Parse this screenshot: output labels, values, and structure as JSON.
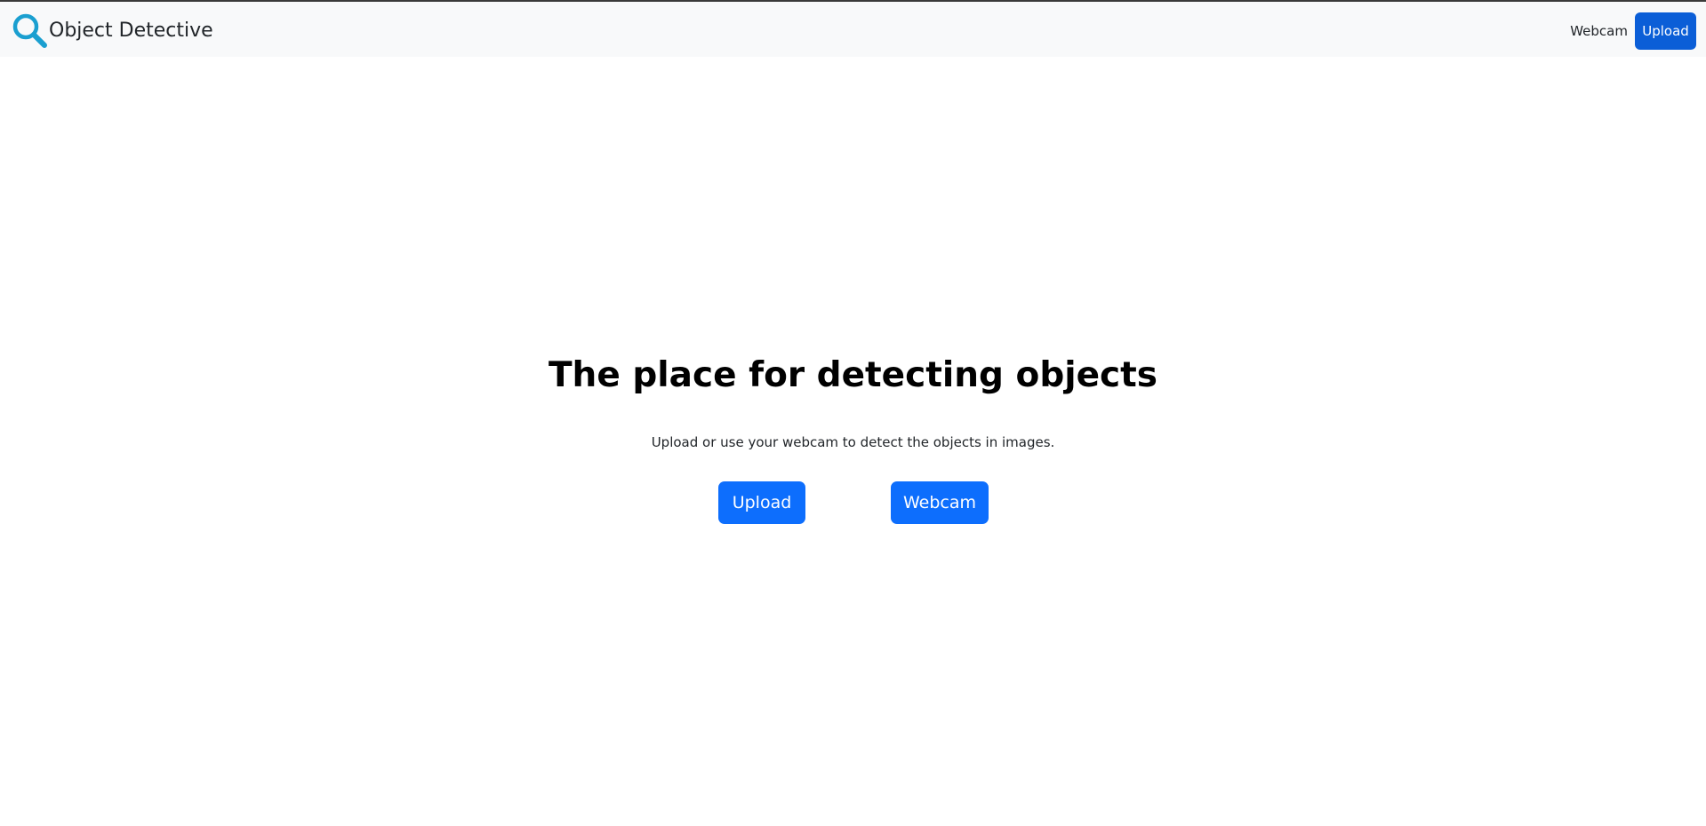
{
  "navbar": {
    "brand_text": "Object Detective",
    "brand_icon": "magnifying-glass-icon",
    "links": {
      "webcam": "Webcam",
      "upload": "Upload"
    }
  },
  "hero": {
    "title": "The place for detecting objects",
    "subtitle": "Upload or use your webcam to detect the objects in images.",
    "buttons": {
      "upload": "Upload",
      "webcam": "Webcam"
    }
  },
  "colors": {
    "navbar_bg": "#f8f9fa",
    "primary": "#0d6efd",
    "primary_dark": "#0b5ed7",
    "icon": "#1a9fd0"
  }
}
